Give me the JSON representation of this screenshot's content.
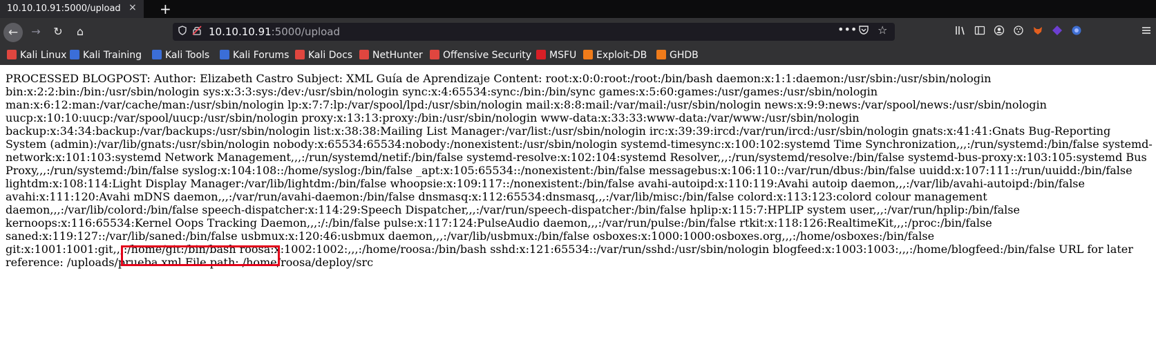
{
  "tab": {
    "title": "10.10.10.91:5000/upload",
    "close": "×",
    "new_tab": "+"
  },
  "nav": {
    "back": "←",
    "forward": "→",
    "reload": "↻",
    "home": "⌂"
  },
  "url": {
    "host": "10.10.10.91",
    "rest": ":5000/upload",
    "dots": "•••"
  },
  "toolbar_icons": [
    "library-icon",
    "sidebar-icon",
    "account-icon",
    "extensions-icon",
    "foxyproxy-icon",
    "addon-icon",
    "addon2-icon",
    "menu-icon"
  ],
  "bookmarks": [
    {
      "label": "Kali Linux",
      "color": "#e0463f"
    },
    {
      "label": "Kali Training",
      "color": "#3b6ed8"
    },
    {
      "label": "Kali Tools",
      "color": "#3b6ed8"
    },
    {
      "label": "Kali Forums",
      "color": "#3b6ed8"
    },
    {
      "label": "Kali Docs",
      "color": "#e0463f"
    },
    {
      "label": "NetHunter",
      "color": "#e0463f"
    },
    {
      "label": "Offensive Security",
      "color": "#e0463f"
    },
    {
      "label": "MSFU",
      "color": "#d81f26"
    },
    {
      "label": "Exploit-DB",
      "color": "#ef7b1a"
    },
    {
      "label": "GHDB",
      "color": "#ef7b1a"
    }
  ],
  "content": {
    "text": "PROCESSED BLOGPOST: Author: Elizabeth Castro Subject: XML Guía de Aprendizaje Content: root:x:0:0:root:/root:/bin/bash daemon:x:1:1:daemon:/usr/sbin:/usr/sbin/nologin bin:x:2:2:bin:/bin:/usr/sbin/nologin sys:x:3:3:sys:/dev:/usr/sbin/nologin sync:x:4:65534:sync:/bin:/bin/sync games:x:5:60:games:/usr/games:/usr/sbin/nologin man:x:6:12:man:/var/cache/man:/usr/sbin/nologin lp:x:7:7:lp:/var/spool/lpd:/usr/sbin/nologin mail:x:8:8:mail:/var/mail:/usr/sbin/nologin news:x:9:9:news:/var/spool/news:/usr/sbin/nologin uucp:x:10:10:uucp:/var/spool/uucp:/usr/sbin/nologin proxy:x:13:13:proxy:/bin:/usr/sbin/nologin www-data:x:33:33:www-data:/var/www:/usr/sbin/nologin backup:x:34:34:backup:/var/backups:/usr/sbin/nologin list:x:38:38:Mailing List Manager:/var/list:/usr/sbin/nologin irc:x:39:39:ircd:/var/run/ircd:/usr/sbin/nologin gnats:x:41:41:Gnats Bug-Reporting System (admin):/var/lib/gnats:/usr/sbin/nologin nobody:x:65534:65534:nobody:/nonexistent:/usr/sbin/nologin systemd-timesync:x:100:102:systemd Time Synchronization,,,:/run/systemd:/bin/false systemd-network:x:101:103:systemd Network Management,,,:/run/systemd/netif:/bin/false systemd-resolve:x:102:104:systemd Resolver,,,:/run/systemd/resolve:/bin/false systemd-bus-proxy:x:103:105:systemd Bus Proxy,,,:/run/systemd:/bin/false syslog:x:104:108::/home/syslog:/bin/false _apt:x:105:65534::/nonexistent:/bin/false messagebus:x:106:110::/var/run/dbus:/bin/false uuidd:x:107:111::/run/uuidd:/bin/false lightdm:x:108:114:Light Display Manager:/var/lib/lightdm:/bin/false whoopsie:x:109:117::/nonexistent:/bin/false avahi-autoipd:x:110:119:Avahi autoip daemon,,,:/var/lib/avahi-autoipd:/bin/false avahi:x:111:120:Avahi mDNS daemon,,,:/var/run/avahi-daemon:/bin/false dnsmasq:x:112:65534:dnsmasq,,,:/var/lib/misc:/bin/false colord:x:113:123:colord colour management daemon,,,:/var/lib/colord:/bin/false speech-dispatcher:x:114:29:Speech Dispatcher,,,:/var/run/speech-dispatcher:/bin/false hplip:x:115:7:HPLIP system user,,,:/var/run/hplip:/bin/false kernoops:x:116:65534:Kernel Oops Tracking Daemon,,,:/:/bin/false pulse:x:117:124:PulseAudio daemon,,,:/var/run/pulse:/bin/false rtkit:x:118:126:RealtimeKit,,,:/proc:/bin/false saned:x:119:127::/var/lib/saned:/bin/false usbmux:x:120:46:usbmux daemon,,,:/var/lib/usbmux:/bin/false osboxes:x:1000:1000:osboxes.org,,,:/home/osboxes:/bin/false git:x:1001:1001:git,,,:/home/git:/bin/bash roosa:x:1002:1002:,,,:/home/roosa:/bin/bash sshd:x:121:65534::/var/run/sshd:/usr/sbin/nologin blogfeed:x:1003:1003:,,,:/home/blogfeed:/bin/false URL for later reference: /uploads/prueba.xml File path: /home/roosa/deploy/src"
  },
  "highlight_color": "#e3051b"
}
